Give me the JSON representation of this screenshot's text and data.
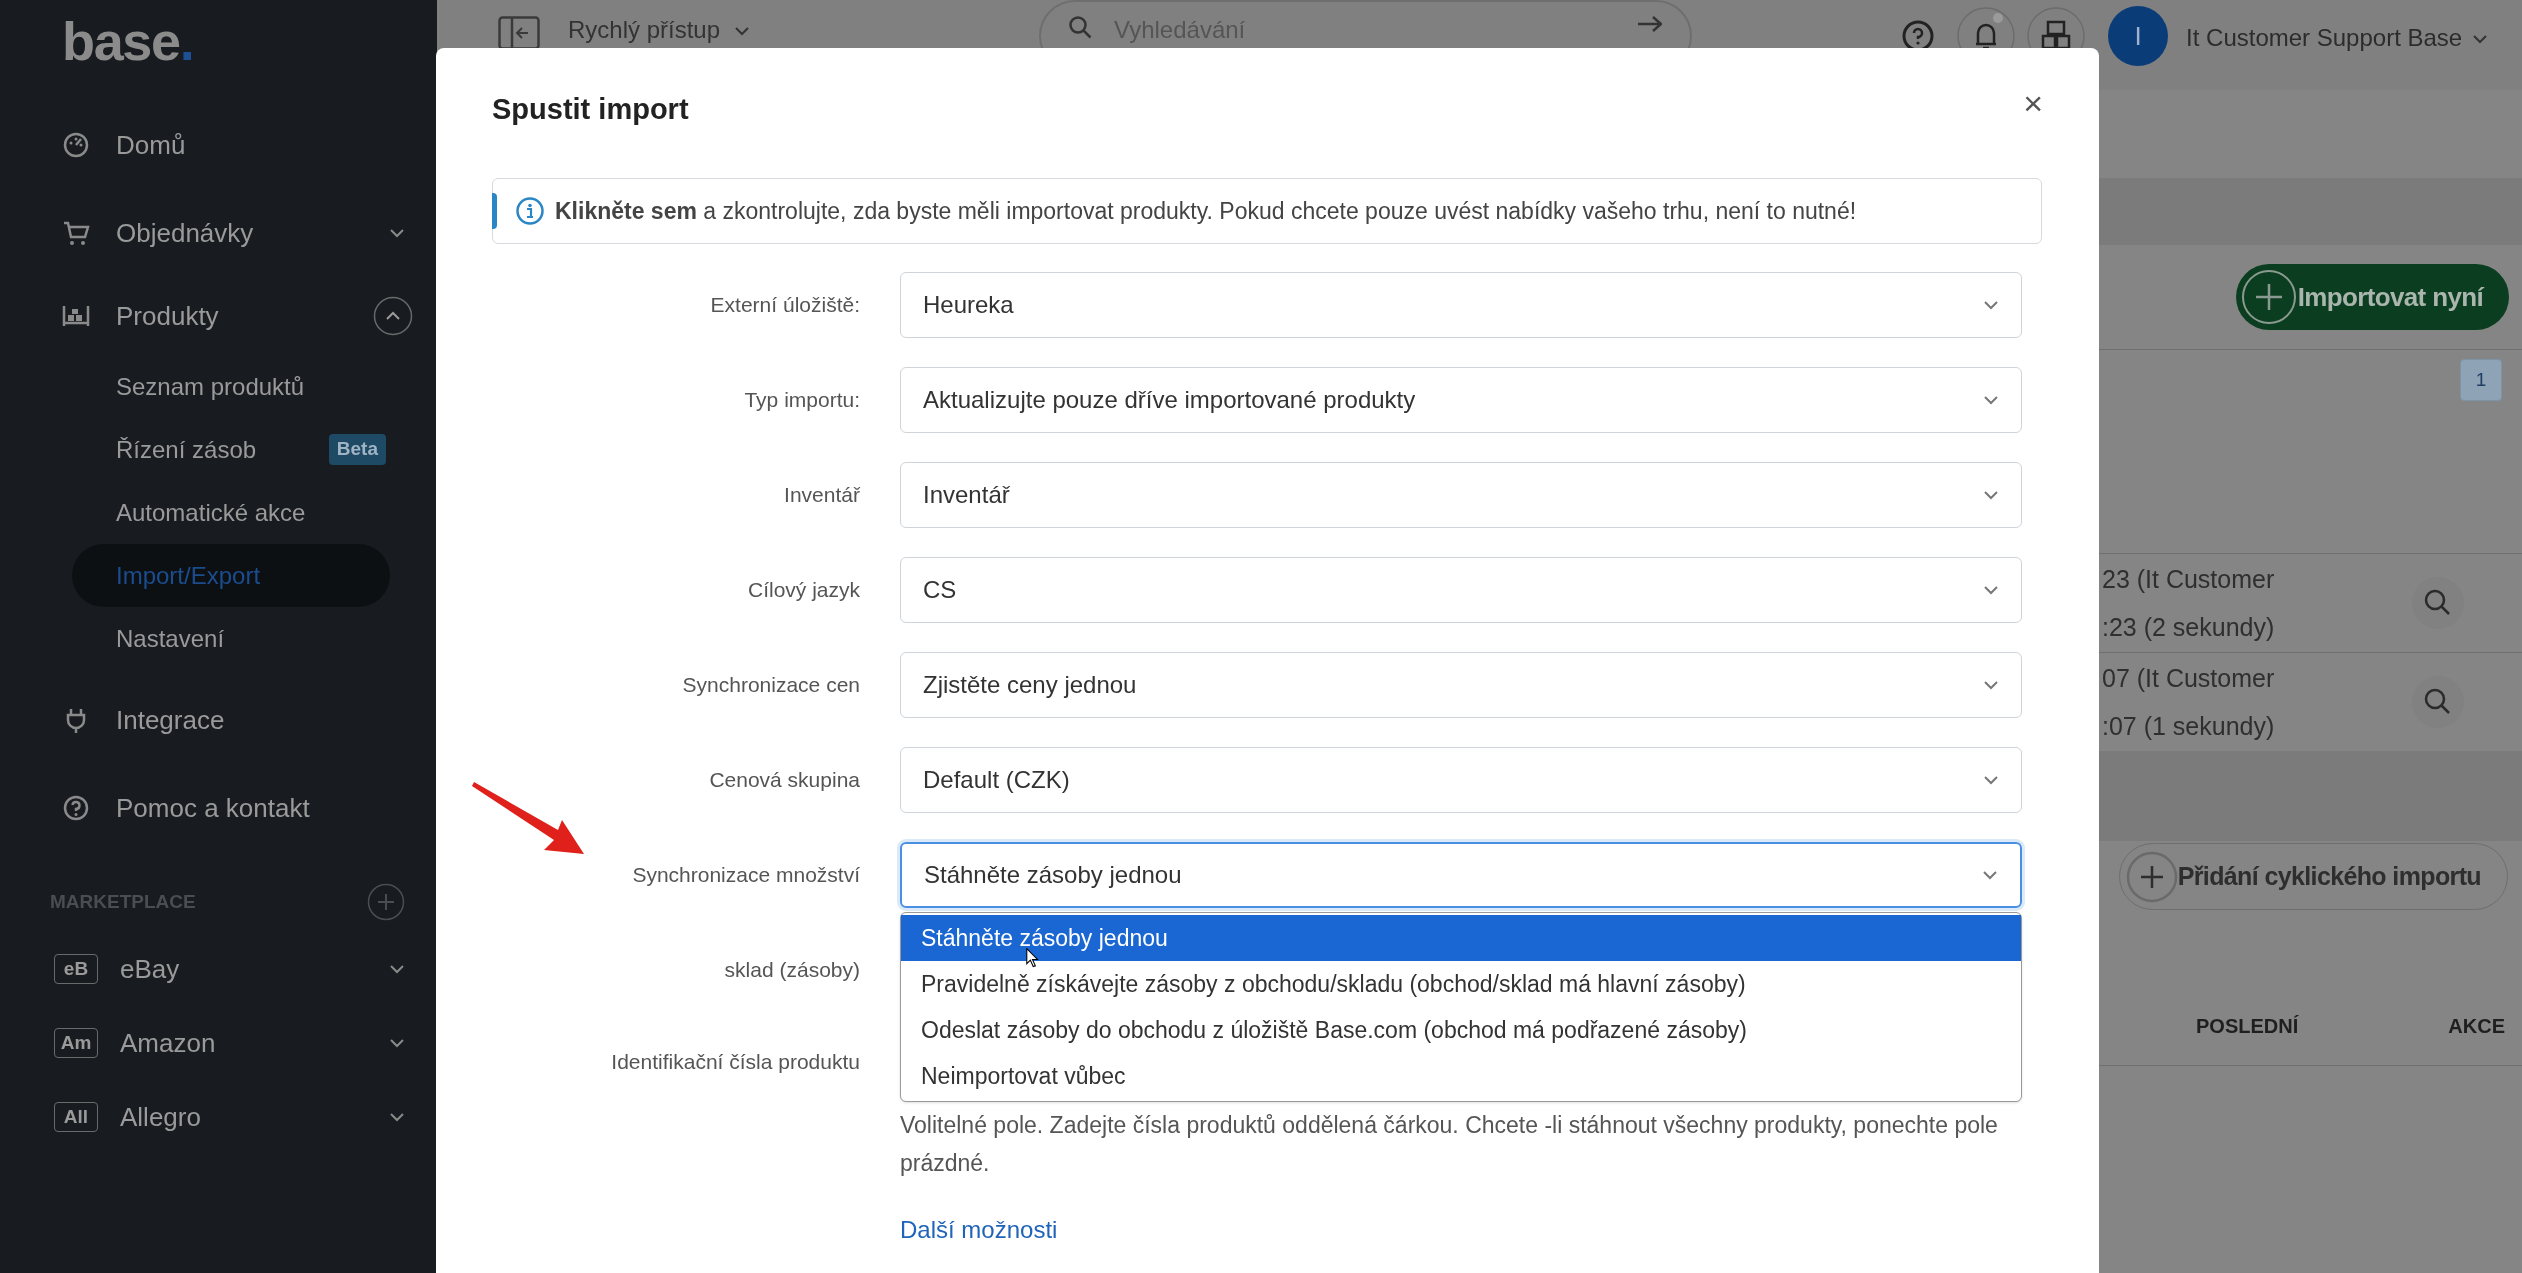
{
  "sidebar": {
    "logo": "base",
    "logo_dot": ".",
    "items": [
      {
        "label": "Domů"
      },
      {
        "label": "Objednávky",
        "expanded": false
      },
      {
        "label": "Produkty",
        "expanded": true,
        "children": [
          {
            "label": "Seznam produktů",
            "selected": false
          },
          {
            "label": "Řízení zásob",
            "badge": "Beta",
            "selected": false
          },
          {
            "label": "Automatické akce",
            "selected": false
          },
          {
            "label": "Import/Export",
            "selected": true
          },
          {
            "label": "Nastavení",
            "selected": false
          }
        ]
      },
      {
        "label": "Integrace"
      },
      {
        "label": "Pomoc a kontakt"
      }
    ],
    "marketplace": {
      "title": "MARKETPLACE",
      "items": [
        {
          "tag": "eB",
          "label": "eBay",
          "expanded": false
        },
        {
          "tag": "Am",
          "label": "Amazon",
          "expanded": false
        },
        {
          "tag": "All",
          "label": "Allegro",
          "expanded": false
        }
      ]
    }
  },
  "top_bar": {
    "quick_access": "Rychlý přístup",
    "search": {
      "placeholder": "Vyhledávání"
    },
    "avatar_initial": "I",
    "user_name": "It Customer Support Base"
  },
  "page": {
    "import_now_button": "Importovat nyní",
    "page_number": "1",
    "rows": [
      {
        "line_1": "23 (It Customer",
        "line_2": ":23 (2 sekundy)"
      },
      {
        "line_1": "07 (It Customer",
        "line_2": ":07 (1 sekundy)"
      }
    ],
    "add_cyclic_button": "Přidání cyklického importu",
    "columns": [
      "POSLEDNÍ",
      "AKCE"
    ]
  },
  "modal": {
    "title": "Spustit import",
    "close": "×",
    "info": "**Klikněte sem** a zkontrolujte, zda byste měli importovat produkty. Pokud chcete pouze uvést nabídky vašeho trhu, není to nutné!",
    "fields": [
      {
        "label": "Externí úložiště:",
        "value": "Heureka",
        "focused": false
      },
      {
        "label": "Typ importu:",
        "value": "Aktualizujte pouze dříve importované produkty",
        "focused": false
      },
      {
        "label": "Inventář",
        "value": "Inventář",
        "focused": false
      },
      {
        "label": "Cílový jazyk",
        "value": "CS",
        "focused": false
      },
      {
        "label": "Synchronizace cen",
        "value": "Zjistěte ceny jednou",
        "focused": false
      },
      {
        "label": "Cenová skupina",
        "value": "Default (CZK)",
        "focused": false
      },
      {
        "label": "Synchronizace množství",
        "value": "Stáhněte zásoby jednou",
        "focused": true
      }
    ],
    "open_dropdown": {
      "options": [
        {
          "label": "Stáhněte zásoby jednou",
          "selected": true
        },
        {
          "label": "Pravidelně získávejte zásoby z obchodu/skladu (obchod/sklad má hlavní zásoby)",
          "selected": false
        },
        {
          "label": "Odeslat zásoby do obchodu z úložiště Base.com (obchod má podřazené zásoby)",
          "selected": false
        },
        {
          "label": "Neimportovat vůbec",
          "selected": false
        }
      ]
    },
    "covered_fields": [
      {
        "label": "sklad (zásoby)"
      },
      {
        "label": "Identifikační čísla produktu"
      }
    ],
    "help_text": "Volitelné pole. Zadejte čísla produktů oddělená čárkou. Chcete -li stáhnout všechny produkty, ponechte pole prázdné.",
    "more_options_link": "Další možnosti"
  }
}
